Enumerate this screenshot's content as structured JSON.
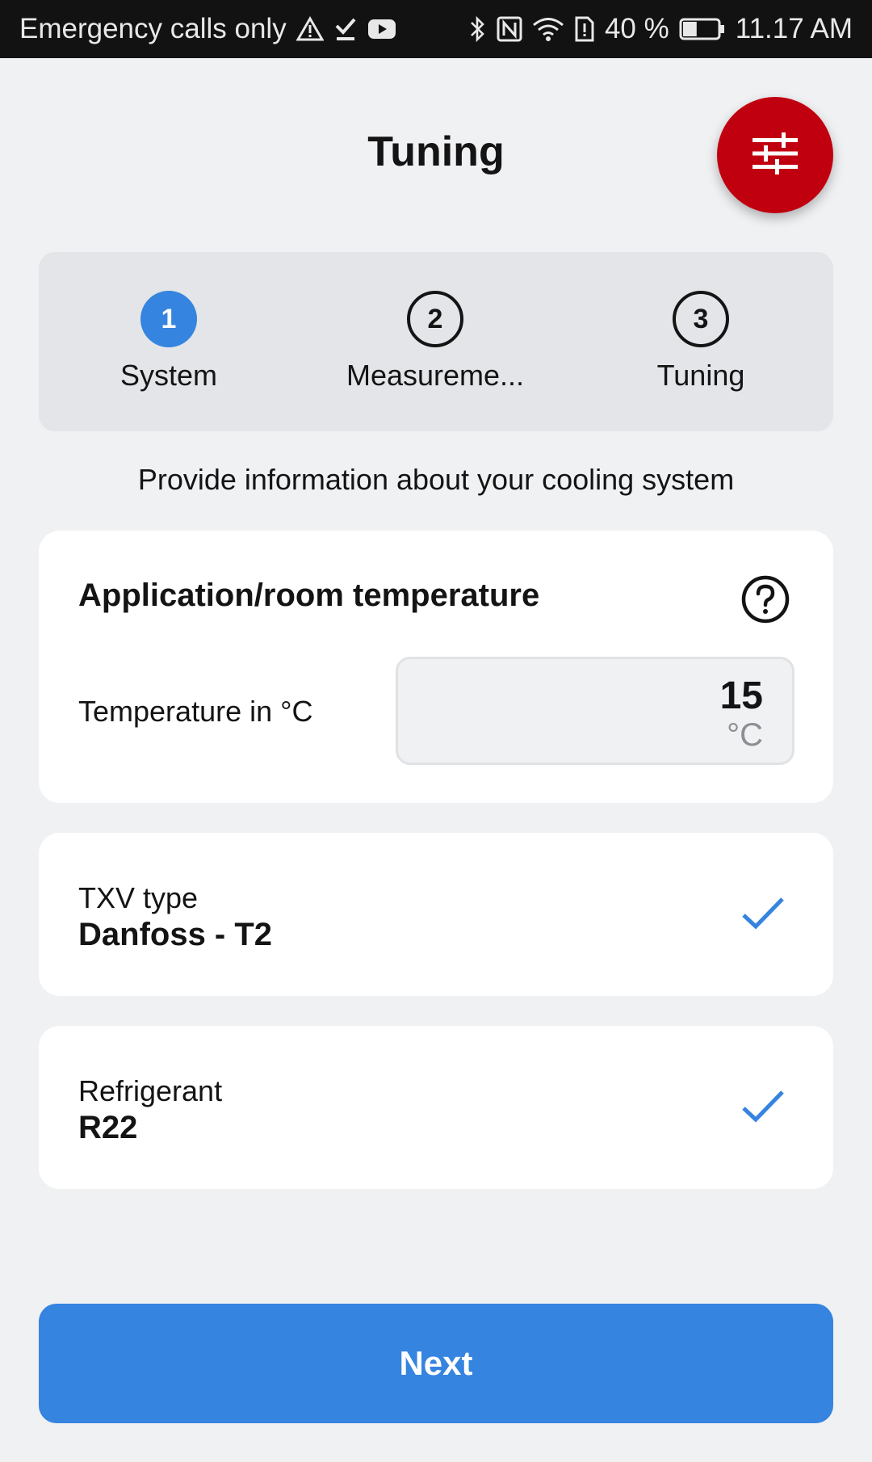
{
  "status_bar": {
    "carrier_text": "Emergency calls only",
    "battery_percent": "40 %",
    "time": "11.17 AM",
    "left_icons": [
      "warning-icon",
      "check-download-icon",
      "youtube-icon"
    ],
    "right_icons": [
      "bluetooth-icon",
      "nfc-icon",
      "wifi-icon",
      "sim-alert-icon",
      "battery-icon"
    ],
    "battery_level": 0.4
  },
  "header": {
    "title": "Tuning",
    "action_icon": "sliders-icon"
  },
  "stepper": {
    "steps": [
      {
        "number": "1",
        "label": "System",
        "active": true
      },
      {
        "number": "2",
        "label": "Measureme...",
        "active": false
      },
      {
        "number": "3",
        "label": "Tuning",
        "active": false
      }
    ]
  },
  "subtitle": "Provide information about your cooling system",
  "temperature_card": {
    "title": "Application/room temperature",
    "label": "Temperature in °C",
    "value": "15",
    "unit": "°C"
  },
  "txv_card": {
    "label": "TXV type",
    "value": "Danfoss - T2"
  },
  "refrigerant_card": {
    "label": "Refrigerant",
    "value": "R22"
  },
  "next_button": {
    "label": "Next"
  },
  "colors": {
    "accent": "#3584e0",
    "brand_red": "#c0000f",
    "background": "#f0f1f3"
  }
}
